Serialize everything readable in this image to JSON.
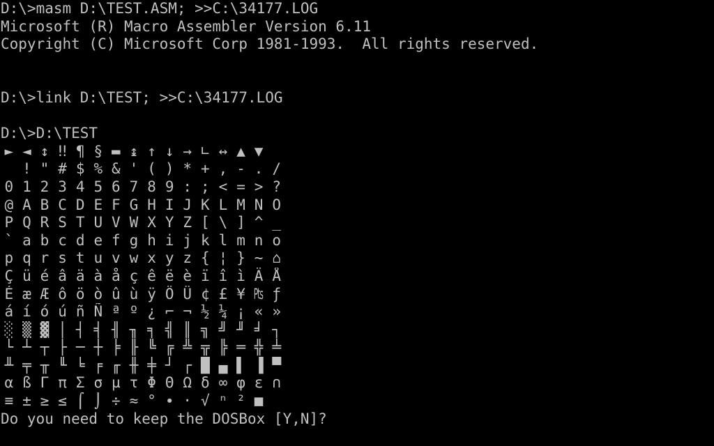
{
  "console": {
    "lines": [
      "D:\\>masm D:\\TEST.ASM; >>C:\\34177.LOG",
      "Microsoft (R) Macro Assembler Version 6.11",
      "Copyright (C) Microsoft Corp 1981-1993.  All rights reserved.",
      "",
      "",
      "D:\\>link D:\\TEST; >>C:\\34177.LOG",
      "",
      "D:\\>D:\\TEST"
    ],
    "charset_rows": [
      [
        "►",
        "◄",
        "↕",
        "‼",
        "¶",
        "§",
        "▬",
        "↨",
        "↑",
        "↓",
        "→",
        "∟",
        "↔",
        "▲",
        "▼",
        ""
      ],
      [
        " ",
        "!",
        "\"",
        "#",
        "$",
        "%",
        "&",
        "'",
        "(",
        ")",
        "*",
        "+",
        ",",
        "-",
        ".",
        "/"
      ],
      [
        "0",
        "1",
        "2",
        "3",
        "4",
        "5",
        "6",
        "7",
        "8",
        "9",
        ":",
        ";",
        "<",
        "=",
        ">",
        "?"
      ],
      [
        "@",
        "A",
        "B",
        "C",
        "D",
        "E",
        "F",
        "G",
        "H",
        "I",
        "J",
        "K",
        "L",
        "M",
        "N",
        "O"
      ],
      [
        "P",
        "Q",
        "R",
        "S",
        "T",
        "U",
        "V",
        "W",
        "X",
        "Y",
        "Z",
        "[",
        "\\",
        "]",
        "^",
        "_"
      ],
      [
        "`",
        "a",
        "b",
        "c",
        "d",
        "e",
        "f",
        "g",
        "h",
        "i",
        "j",
        "k",
        "l",
        "m",
        "n",
        "o"
      ],
      [
        "p",
        "q",
        "r",
        "s",
        "t",
        "u",
        "v",
        "w",
        "x",
        "y",
        "z",
        "{",
        "¦",
        "}",
        "~",
        "⌂"
      ],
      [
        "Ç",
        "ü",
        "é",
        "â",
        "ä",
        "à",
        "å",
        "ç",
        "ê",
        "ë",
        "è",
        "ï",
        "î",
        "ì",
        "Ä",
        "Å"
      ],
      [
        "É",
        "æ",
        "Æ",
        "ô",
        "ö",
        "ò",
        "û",
        "ù",
        "ÿ",
        "Ö",
        "Ü",
        "¢",
        "£",
        "¥",
        "₧",
        "ƒ"
      ],
      [
        "á",
        "í",
        "ó",
        "ú",
        "ñ",
        "Ñ",
        "ª",
        "º",
        "¿",
        "⌐",
        "¬",
        "½",
        "¼",
        "¡",
        "«",
        "»"
      ],
      [
        "░",
        "▒",
        "▓",
        "│",
        "┤",
        "╡",
        "╢",
        "╖",
        "╕",
        "╣",
        "║",
        "╗",
        "╝",
        "╜",
        "╛",
        "┐"
      ],
      [
        "└",
        "┴",
        "┬",
        "├",
        "─",
        "┼",
        "╞",
        "╟",
        "╚",
        "╔",
        "╩",
        "╦",
        "╠",
        "═",
        "╬",
        "╧"
      ],
      [
        "╨",
        "╤",
        "╥",
        "╙",
        "╘",
        "╒",
        "╓",
        "╫",
        "╪",
        "┘",
        "┌",
        "█",
        "▄",
        "▌",
        "▐",
        "▀"
      ],
      [
        "α",
        "ß",
        "Γ",
        "π",
        "Σ",
        "σ",
        "µ",
        "τ",
        "Φ",
        "Θ",
        "Ω",
        "δ",
        "∞",
        "φ",
        "ε",
        "∩"
      ],
      [
        "≡",
        "±",
        "≥",
        "≤",
        "⌠",
        "⌡",
        "÷",
        "≈",
        "°",
        "∙",
        "·",
        "√",
        "ⁿ",
        "²",
        "■",
        ""
      ]
    ],
    "prompt": "Do you need to keep the DOSBox [Y,N]?"
  },
  "colors": {
    "background": "#000000",
    "foreground": "#c0c0c0"
  }
}
